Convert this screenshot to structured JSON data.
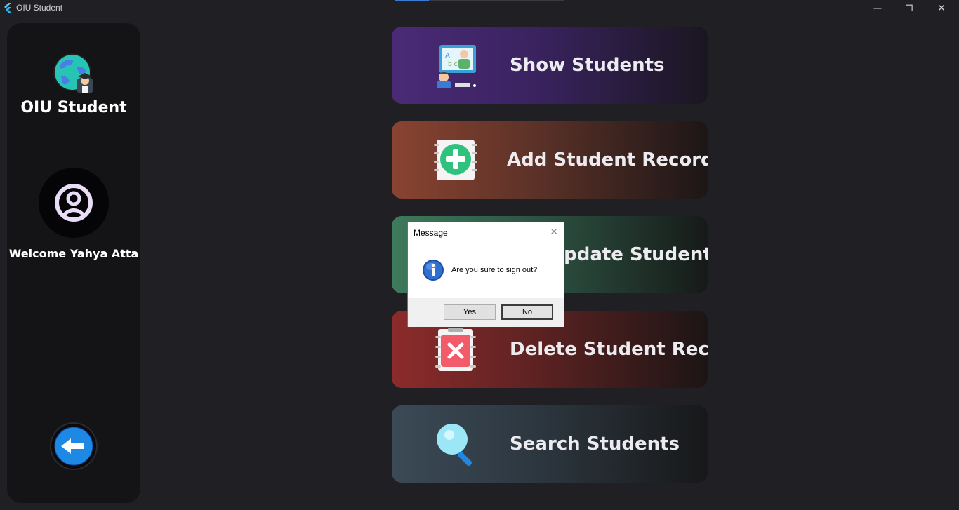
{
  "window": {
    "title": "OIU Student",
    "controls": {
      "minimize": "—",
      "maximize": "❐",
      "close": "✕"
    }
  },
  "sidebar": {
    "app_name": "OIU Student",
    "welcome": "Welcome Yahya Atta",
    "icons": {
      "logo": "globe-graduate-icon",
      "avatar": "user-circle-icon",
      "back": "arrow-left-icon"
    }
  },
  "actions": [
    {
      "label": "Show Students",
      "icon": "classroom-icon"
    },
    {
      "label": "Add Student Record",
      "icon": "add-record-icon"
    },
    {
      "label": "Update Student Record",
      "icon": "edit-record-icon"
    },
    {
      "label": "Delete Student Record",
      "icon": "delete-record-icon"
    },
    {
      "label": "Search Students",
      "icon": "magnifier-icon"
    }
  ],
  "dialog": {
    "title": "Message",
    "message": "Are you sure to sign out?",
    "yes": "Yes",
    "no": "No",
    "icon": "info-icon"
  },
  "colors": {
    "background": "#202024",
    "sidebar": "#141416",
    "show": "#4a2a76",
    "add": "#8a4330",
    "update": "#3e7a5c",
    "delete": "#8c2b2b",
    "search": "#3b4a56"
  }
}
